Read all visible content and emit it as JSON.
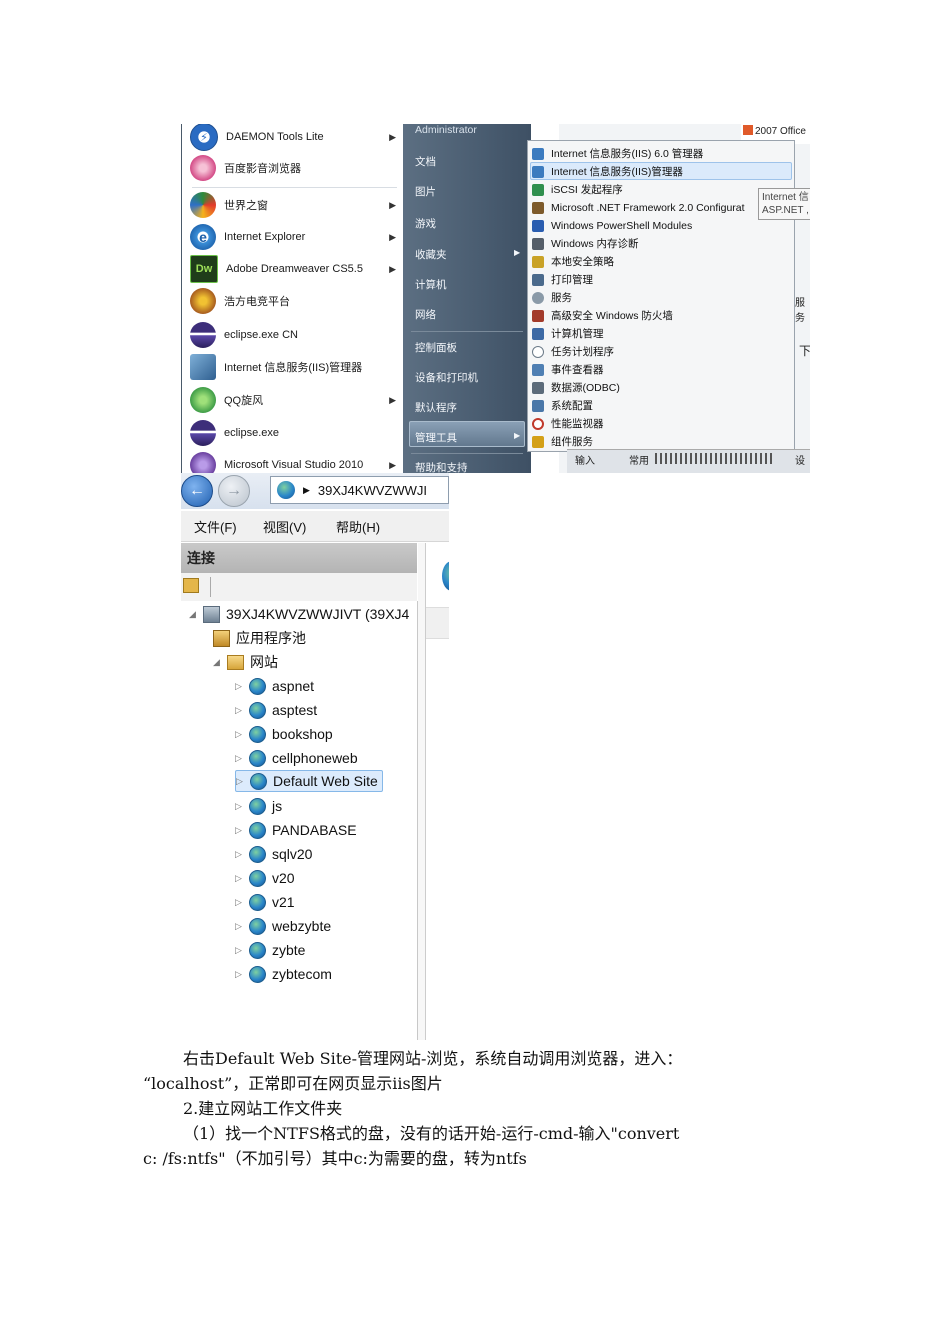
{
  "start_menu": {
    "programs": [
      {
        "label": "DAEMON Tools Lite",
        "icon": "daemon-tools-icon",
        "arrow": true
      },
      {
        "label": "百度影音浏览器",
        "icon": "baidu-player-icon",
        "arrow": false
      },
      {
        "label": "世界之窗",
        "icon": "theworld-browser-icon",
        "arrow": true
      },
      {
        "label": "Internet Explorer",
        "icon": "internet-explorer-icon",
        "arrow": true
      },
      {
        "label": "Adobe Dreamweaver CS5.5",
        "icon": "dreamweaver-icon",
        "icon_text": "Dw",
        "arrow": true
      },
      {
        "label": "浩方电竞平台",
        "icon": "haofang-icon",
        "arrow": false
      },
      {
        "label": "eclipse.exe CN",
        "icon": "eclipse-icon",
        "arrow": false
      },
      {
        "label": "Internet 信息服务(IIS)管理器",
        "icon": "iis-manager-icon",
        "arrow": false
      },
      {
        "label": "QQ旋风",
        "icon": "qq-xuanfeng-icon",
        "arrow": true
      },
      {
        "label": "eclipse.exe",
        "icon": "eclipse-icon",
        "arrow": false
      },
      {
        "label": "Microsoft Visual Studio 2010",
        "icon": "visual-studio-icon",
        "arrow": true
      }
    ],
    "right_items": [
      {
        "label": "Administrator"
      },
      {
        "label": "文档"
      },
      {
        "label": "图片"
      },
      {
        "label": "游戏"
      },
      {
        "label": "收藏夹",
        "arrow": true
      },
      {
        "label": "计算机"
      },
      {
        "label": "网络"
      },
      {
        "label": "控制面板"
      },
      {
        "label": "设备和打印机"
      },
      {
        "label": "默认程序"
      },
      {
        "label": "管理工具",
        "arrow": true
      },
      {
        "label": "帮助和支持"
      }
    ],
    "admin_tools": [
      {
        "label": "Internet 信息服务(IIS) 6.0 管理器",
        "color": "#3c7bbf"
      },
      {
        "label": "Internet 信息服务(IIS)管理器",
        "color": "#3c7bbf"
      },
      {
        "label": "iSCSI 发起程序",
        "color": "#2f8f4e"
      },
      {
        "label": "Microsoft .NET Framework 2.0 Configurat",
        "color": "#7d5a2b"
      },
      {
        "label": "Windows PowerShell Modules",
        "color": "#2a5db0"
      },
      {
        "label": "Windows 内存诊断",
        "color": "#555e69"
      },
      {
        "label": "本地安全策略",
        "color": "#c9a227"
      },
      {
        "label": "打印管理",
        "color": "#4b6a8c"
      },
      {
        "label": "服务",
        "color": "#8a9aa8"
      },
      {
        "label": "高级安全 Windows 防火墙",
        "color": "#a33b2b"
      },
      {
        "label": "计算机管理",
        "color": "#3d6aa5"
      },
      {
        "label": "任务计划程序",
        "color": "#6b7a88"
      },
      {
        "label": "事件查看器",
        "color": "#4f7fb3"
      },
      {
        "label": "数据源(ODBC)",
        "color": "#5c6b7a"
      },
      {
        "label": "系统配置",
        "color": "#4a77a8"
      },
      {
        "label": "性能监视器",
        "color": "#c0392b"
      },
      {
        "label": "组件服务",
        "color": "#d4a017"
      }
    ],
    "background_text": {
      "office": "2007 Office",
      "tooltip_line1": "Internet 信",
      "tooltip_line2": "ASP.NET ,",
      "strip_left": "输入",
      "strip_mid": "常用",
      "strip_right": "设",
      "fragment_a": "服务",
      "fragment_b": "下"
    }
  },
  "iis": {
    "address": "39XJ4KWVZWWJI",
    "menu": [
      "文件(F)",
      "视图(V)",
      "帮助(H)"
    ],
    "connections_title": "连接",
    "server_node": "39XJ4KWVZWWJIVT (39XJ4",
    "app_pools": "应用程序池",
    "sites_node": "网站",
    "sites": [
      "aspnet",
      "asptest",
      "bookshop",
      "cellphoneweb",
      "Default Web Site",
      "js",
      "PANDABASE",
      "sqlv20",
      "v20",
      "v21",
      "webzybte",
      "zybte",
      "zybtecom"
    ],
    "selected_site": "Default Web Site"
  },
  "document": {
    "para1_line1": "右击Default Web Site-管理网站-浏览，系统自动调用浏览器，进入：",
    "para1_line2": "“localhost”，正常即可在网页显示iis图片",
    "heading2": "2.建立网站工作文件夹",
    "para2_line1": "（1）找一个NTFS格式的盘，没有的话开始-运行-cmd-输入\"convert",
    "para2_line2": "c: /fs:ntfs\"（不加引号）其中c:为需要的盘，转为ntfs"
  }
}
